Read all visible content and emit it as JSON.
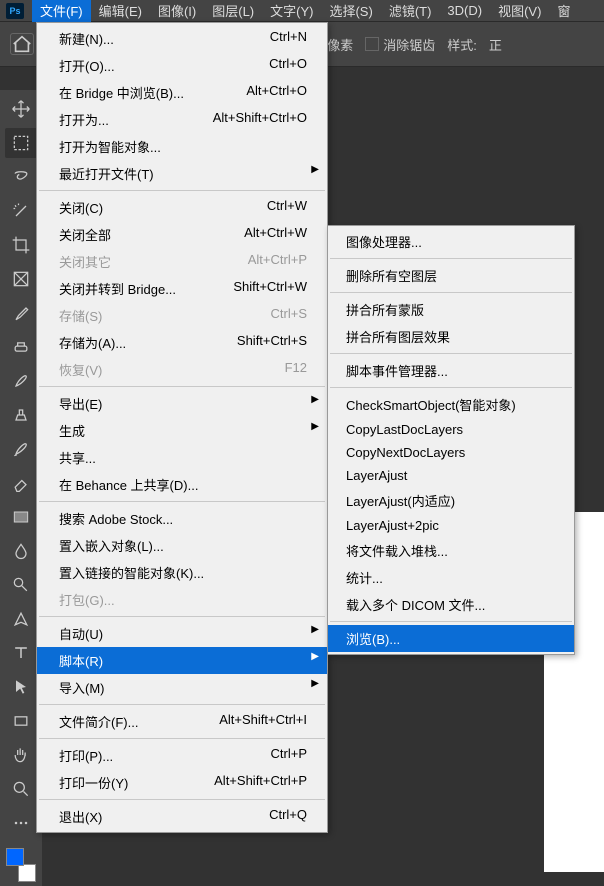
{
  "menubar": {
    "items": [
      "文件(F)",
      "编辑(E)",
      "图像(I)",
      "图层(L)",
      "文字(Y)",
      "选择(S)",
      "滤镜(T)",
      "3D(D)",
      "视图(V)",
      "窗"
    ]
  },
  "options_bar": {
    "pixels": "像素",
    "anti_alias": "消除锯齿",
    "style": "样式:",
    "style_val": "正"
  },
  "tab_hint": "",
  "file_menu": {
    "items": [
      {
        "label": "新建(N)...",
        "shortcut": "Ctrl+N"
      },
      {
        "label": "打开(O)...",
        "shortcut": "Ctrl+O"
      },
      {
        "label": "在 Bridge 中浏览(B)...",
        "shortcut": "Alt+Ctrl+O"
      },
      {
        "label": "打开为...",
        "shortcut": "Alt+Shift+Ctrl+O"
      },
      {
        "label": "打开为智能对象..."
      },
      {
        "label": "最近打开文件(T)",
        "sub": true
      },
      {
        "sep": true
      },
      {
        "label": "关闭(C)",
        "shortcut": "Ctrl+W"
      },
      {
        "label": "关闭全部",
        "shortcut": "Alt+Ctrl+W"
      },
      {
        "label": "关闭其它",
        "shortcut": "Alt+Ctrl+P",
        "disabled": true
      },
      {
        "label": "关闭并转到 Bridge...",
        "shortcut": "Shift+Ctrl+W"
      },
      {
        "label": "存储(S)",
        "shortcut": "Ctrl+S",
        "disabled": true
      },
      {
        "label": "存储为(A)...",
        "shortcut": "Shift+Ctrl+S"
      },
      {
        "label": "恢复(V)",
        "shortcut": "F12",
        "disabled": true
      },
      {
        "sep": true
      },
      {
        "label": "导出(E)",
        "sub": true
      },
      {
        "label": "生成",
        "sub": true
      },
      {
        "label": "共享..."
      },
      {
        "label": "在 Behance 上共享(D)..."
      },
      {
        "sep": true
      },
      {
        "label": "搜索 Adobe Stock..."
      },
      {
        "label": "置入嵌入对象(L)..."
      },
      {
        "label": "置入链接的智能对象(K)..."
      },
      {
        "label": "打包(G)...",
        "disabled": true
      },
      {
        "sep": true
      },
      {
        "label": "自动(U)",
        "sub": true
      },
      {
        "label": "脚本(R)",
        "sub": true,
        "highlight": true
      },
      {
        "label": "导入(M)",
        "sub": true
      },
      {
        "sep": true
      },
      {
        "label": "文件简介(F)...",
        "shortcut": "Alt+Shift+Ctrl+I"
      },
      {
        "sep": true
      },
      {
        "label": "打印(P)...",
        "shortcut": "Ctrl+P"
      },
      {
        "label": "打印一份(Y)",
        "shortcut": "Alt+Shift+Ctrl+P"
      },
      {
        "sep": true
      },
      {
        "label": "退出(X)",
        "shortcut": "Ctrl+Q"
      }
    ]
  },
  "scripts_submenu": {
    "items": [
      {
        "label": "图像处理器..."
      },
      {
        "sep": true
      },
      {
        "label": "删除所有空图层"
      },
      {
        "sep": true
      },
      {
        "label": "拼合所有蒙版"
      },
      {
        "label": "拼合所有图层效果"
      },
      {
        "sep": true
      },
      {
        "label": "脚本事件管理器..."
      },
      {
        "sep": true
      },
      {
        "label": "CheckSmartObject(智能对象)"
      },
      {
        "label": "CopyLastDocLayers"
      },
      {
        "label": "CopyNextDocLayers"
      },
      {
        "label": "LayerAjust"
      },
      {
        "label": "LayerAjust(内适应)"
      },
      {
        "label": "LayerAjust+2pic"
      },
      {
        "label": "将文件载入堆栈..."
      },
      {
        "label": "统计..."
      },
      {
        "label": "载入多个 DICOM 文件..."
      },
      {
        "sep": true
      },
      {
        "label": "浏览(B)...",
        "highlight": true
      }
    ]
  }
}
